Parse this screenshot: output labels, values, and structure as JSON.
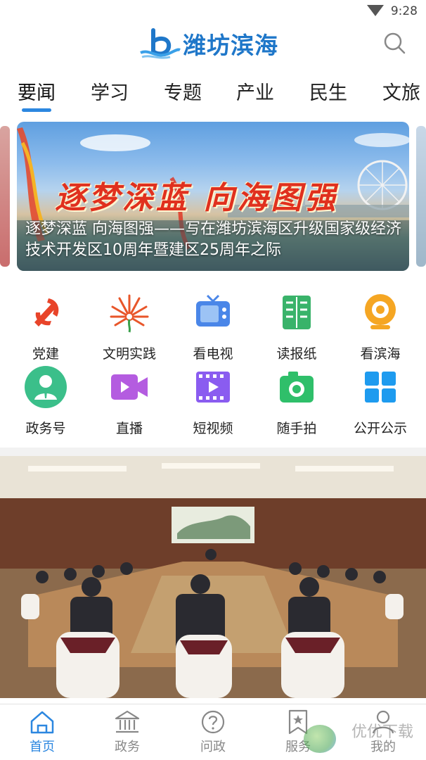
{
  "status_bar": {
    "time": "9:28"
  },
  "header": {
    "app_name": "潍坊滨海"
  },
  "tabs": [
    {
      "label": "要闻",
      "active": true
    },
    {
      "label": "学习"
    },
    {
      "label": "专题"
    },
    {
      "label": "产业"
    },
    {
      "label": "民生"
    },
    {
      "label": "文旅"
    }
  ],
  "banner": {
    "slogan": "逐梦深蓝 向海图强",
    "caption": "逐梦深蓝 向海图强——写在潍坊滨海区升级国家级经济技术开发区10周年暨建区25周年之际"
  },
  "grid": [
    {
      "label": "党建",
      "icon": "party-emblem-icon"
    },
    {
      "label": "文明实践",
      "icon": "fan-flower-icon"
    },
    {
      "label": "看电视",
      "icon": "tv-icon"
    },
    {
      "label": "读报纸",
      "icon": "newspaper-icon"
    },
    {
      "label": "看滨海",
      "icon": "camera-lens-icon"
    },
    {
      "label": "政务号",
      "icon": "official-person-icon"
    },
    {
      "label": "直播",
      "icon": "live-video-icon"
    },
    {
      "label": "短视频",
      "icon": "short-video-icon"
    },
    {
      "label": "随手拍",
      "icon": "photo-camera-icon"
    },
    {
      "label": "公开公示",
      "icon": "tiles-icon"
    }
  ],
  "bottom_nav": [
    {
      "label": "首页",
      "icon": "home-icon",
      "active": true
    },
    {
      "label": "政务",
      "icon": "government-building-icon"
    },
    {
      "label": "问政",
      "icon": "question-icon"
    },
    {
      "label": "服务",
      "icon": "bookmark-star-icon"
    },
    {
      "label": "我的",
      "icon": "user-icon"
    }
  ],
  "watermark": "优优下载",
  "colors": {
    "accent": "#2c87e0",
    "brand_blue": "#1f77c9"
  }
}
